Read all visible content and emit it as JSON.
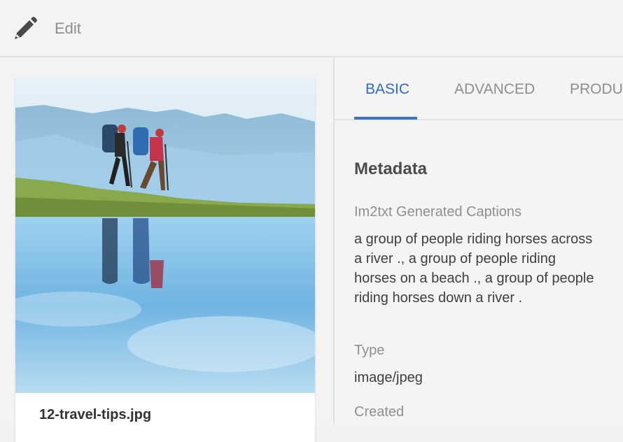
{
  "toolbar": {
    "edit_label": "Edit",
    "edit_icon": "pencil-icon"
  },
  "asset": {
    "filename": "12-travel-tips.jpg",
    "thumbnail_icon": "hikers-lake-photo"
  },
  "tabs": [
    {
      "label": "BASIC",
      "active": true
    },
    {
      "label": "ADVANCED",
      "active": false
    },
    {
      "label": "PRODUC",
      "active": false
    }
  ],
  "metadata": {
    "title": "Metadata",
    "fields": [
      {
        "label": "Im2txt Generated Captions",
        "value": "a group of people riding horses across a river ., a group of people riding horses on a beach ., a group of people riding horses down a river ."
      },
      {
        "label": "Type",
        "value": "image/jpeg"
      },
      {
        "label": "Created",
        "value": ""
      }
    ]
  },
  "colors": {
    "accent": "#3e72c9",
    "active_tab_text": "#2d6bc7"
  }
}
